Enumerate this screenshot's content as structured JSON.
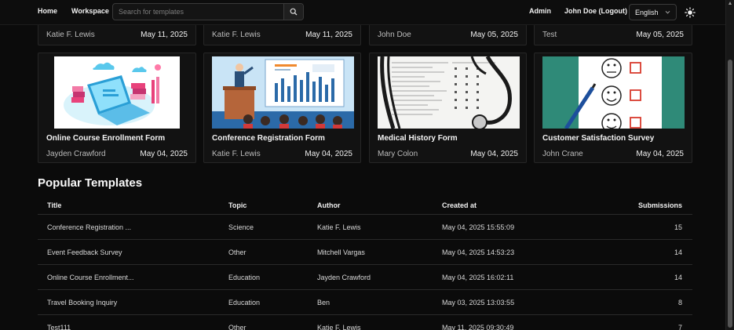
{
  "nav": {
    "home": "Home",
    "workspace": "Workspace",
    "search_placeholder": "Search for templates",
    "admin": "Admin",
    "user": "John Doe (Logout)",
    "language": "English"
  },
  "top_cards": [
    {
      "author": "Katie F. Lewis",
      "date": "May 11, 2025"
    },
    {
      "author": "Katie F. Lewis",
      "date": "May 11, 2025"
    },
    {
      "author": "John Doe",
      "date": "May 05, 2025"
    },
    {
      "author": "Test",
      "date": "May 05, 2025"
    }
  ],
  "cards": [
    {
      "title": "Online Course Enrollment Form",
      "author": "Jayden Crawford",
      "date": "May 04, 2025"
    },
    {
      "title": "Conference Registration Form",
      "author": "Katie F. Lewis",
      "date": "May 04, 2025"
    },
    {
      "title": "Medical History Form",
      "author": "Mary Colon",
      "date": "May 04, 2025"
    },
    {
      "title": "Customer Satisfaction Survey",
      "author": "John Crane",
      "date": "May 04, 2025"
    }
  ],
  "popular": {
    "heading": "Popular Templates",
    "columns": {
      "title": "Title",
      "topic": "Topic",
      "author": "Author",
      "created": "Created at",
      "submissions": "Submissions"
    },
    "rows": [
      {
        "title": "Conference Registration ...",
        "topic": "Science",
        "author": "Katie F. Lewis",
        "created": "May 04, 2025 15:55:09",
        "submissions": "15"
      },
      {
        "title": "Event Feedback Survey",
        "topic": "Other",
        "author": "Mitchell Vargas",
        "created": "May 04, 2025 14:53:23",
        "submissions": "14"
      },
      {
        "title": "Online Course Enrollment...",
        "topic": "Education",
        "author": "Jayden Crawford",
        "created": "May 04, 2025 16:02:11",
        "submissions": "14"
      },
      {
        "title": "Travel Booking Inquiry",
        "topic": "Education",
        "author": "Ben",
        "created": "May 03, 2025 13:03:55",
        "submissions": "8"
      },
      {
        "title": "Test111",
        "topic": "Other",
        "author": "Katie F. Lewis",
        "created": "May 11, 2025 09:30:49",
        "submissions": "7"
      }
    ]
  },
  "icons": {
    "search": "search-icon",
    "language_chevron": "chevron-down-icon",
    "theme": "sun-icon"
  }
}
